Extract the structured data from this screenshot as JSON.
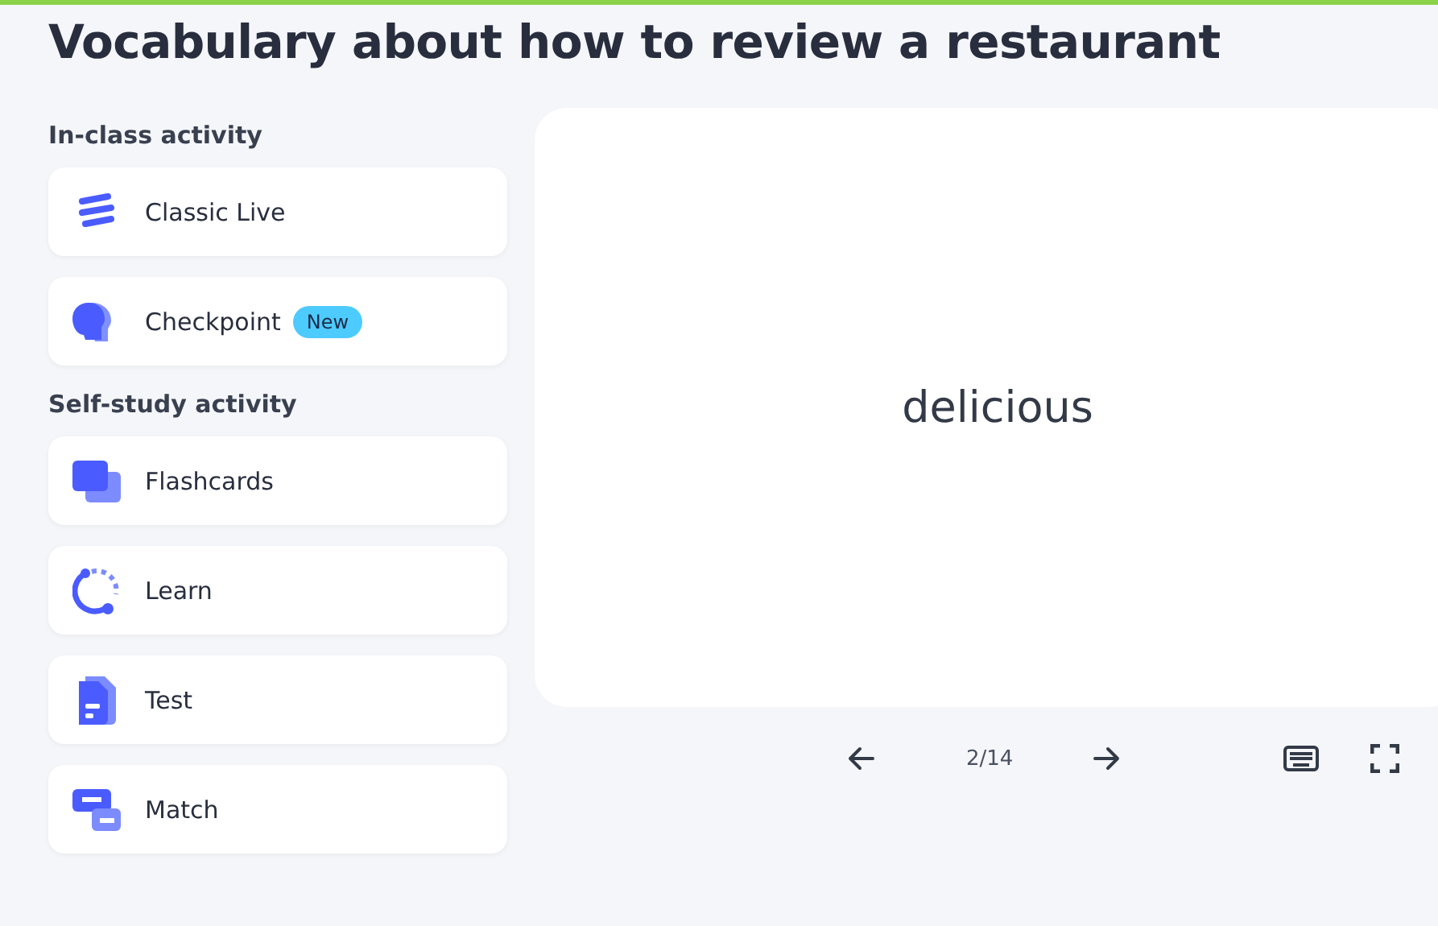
{
  "title": "Vocabulary about how to review a restaurant",
  "sections": [
    {
      "heading": "In-class activity",
      "activities": [
        {
          "kind": "live",
          "label": "Classic Live"
        },
        {
          "kind": "checkpoint",
          "label": "Checkpoint",
          "badge": "New"
        }
      ]
    },
    {
      "heading": "Self-study activity",
      "activities": [
        {
          "kind": "flashcards",
          "label": "Flashcards"
        },
        {
          "kind": "learn",
          "label": "Learn"
        },
        {
          "kind": "test",
          "label": "Test"
        },
        {
          "kind": "match",
          "label": "Match"
        }
      ]
    }
  ],
  "flashcard": {
    "term": "delicious"
  },
  "navigation": {
    "counter": "2/14"
  }
}
